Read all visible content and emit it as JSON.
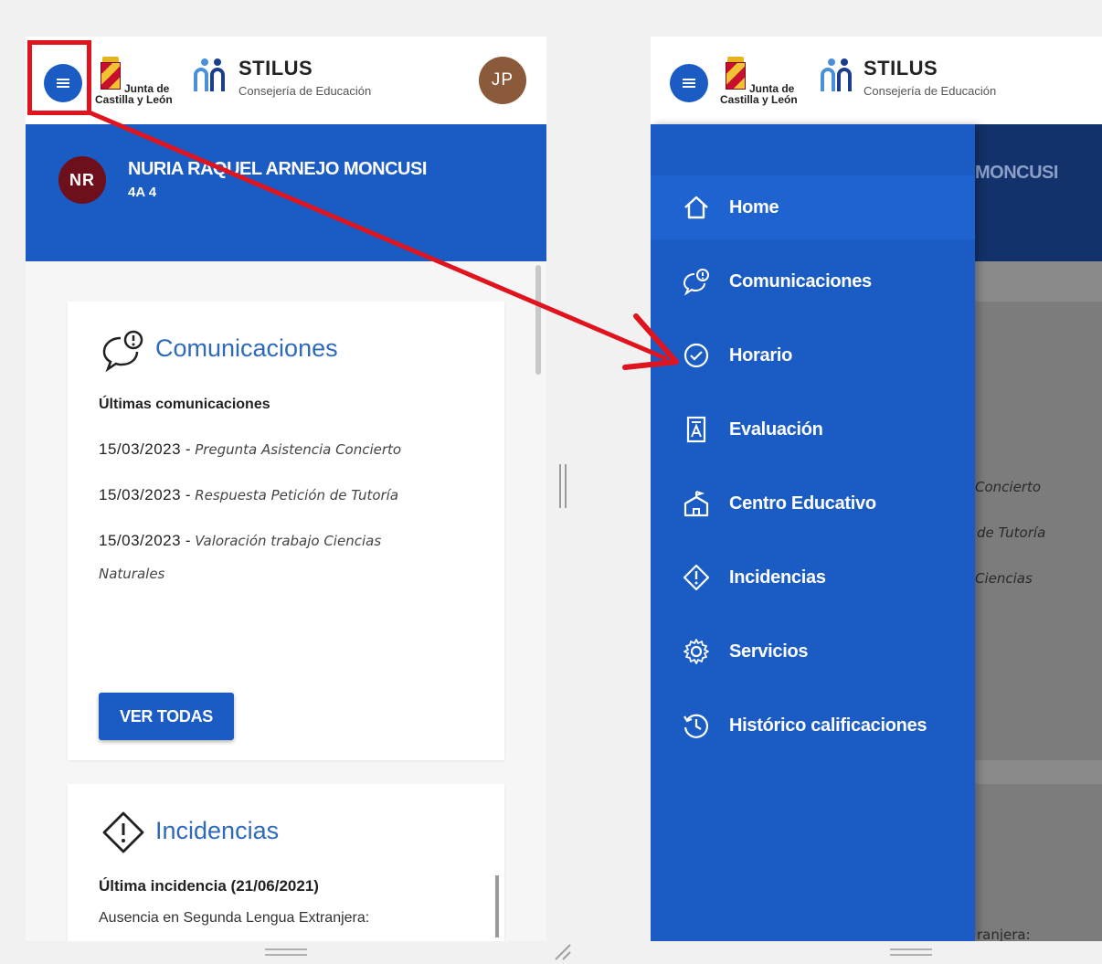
{
  "left_panel": {
    "header": {
      "junta_line1": "Junta de",
      "junta_line2": "Castilla y León",
      "app_name": "STILUS",
      "app_subtitle": "Consejería de Educación",
      "user_initials": "JP"
    },
    "student": {
      "initials": "NR",
      "name": "NURIA RAQUEL ARNEJO MONCUSI",
      "class": "4A 4"
    },
    "comunicaciones": {
      "title": "Comunicaciones",
      "subtitle": "Últimas comunicaciones",
      "messages": [
        {
          "date": "15/03/2023",
          "sep": " - ",
          "text": "Pregunta Asistencia Concierto"
        },
        {
          "date": "15/03/2023",
          "sep": " - ",
          "text": "Respuesta Petición de Tutoría"
        },
        {
          "date": "15/03/2023",
          "sep": " - ",
          "text": "Valoración trabajo Ciencias Naturales"
        }
      ],
      "button": "VER TODAS"
    },
    "incidencias": {
      "title": "Incidencias",
      "last_label": "Última incidencia (21/06/2021)",
      "text": "Ausencia en Segunda Lengua Extranjera:"
    }
  },
  "right_panel": {
    "header": {
      "junta_line1": "Junta de",
      "junta_line2": "Castilla y León",
      "app_name": "STILUS",
      "app_subtitle": "Consejería de Educación"
    },
    "clipped": {
      "name": "MONCUSI",
      "msg1": "Concierto",
      "msg2": "de Tutoría",
      "msg3": "Ciencias",
      "inc": "ranjera:"
    },
    "drawer": {
      "items": [
        {
          "label": "Home",
          "icon": "home-icon"
        },
        {
          "label": "Comunicaciones",
          "icon": "chat-alert-icon"
        },
        {
          "label": "Horario",
          "icon": "clock-check-icon"
        },
        {
          "label": "Evaluación",
          "icon": "grade-document-icon"
        },
        {
          "label": "Centro Educativo",
          "icon": "school-icon"
        },
        {
          "label": "Incidencias",
          "icon": "warning-diamond-icon"
        },
        {
          "label": "Servicios",
          "icon": "gear-icon"
        },
        {
          "label": "Histórico calificaciones",
          "icon": "history-icon"
        }
      ]
    }
  },
  "colors": {
    "primary_blue": "#1a5bc4",
    "annotation_red": "#e0141e",
    "title_blue": "#2e6ab8",
    "student_avatar": "#6e0f1c",
    "user_avatar": "#8a5a3b"
  }
}
